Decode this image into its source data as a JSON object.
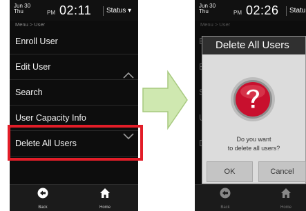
{
  "left_screen": {
    "date_line1": "Jun  30",
    "date_line2": "Thu",
    "ampm": "PM",
    "time": "02:11",
    "status_label": "Status ▾",
    "breadcrumb": "Menu > User",
    "menu_items": [
      "Enroll User",
      "Edit User",
      "Search",
      "User Capacity Info",
      "Delete All Users"
    ],
    "nav": {
      "back": "Back",
      "home": "Home"
    }
  },
  "right_screen": {
    "date_line1": "Jun  30",
    "date_line2": "Thu",
    "ampm": "PM",
    "time": "02:26",
    "status_label": "Statu",
    "breadcrumb": "Menu > User",
    "dimmed_items": [
      "E",
      "E",
      "S",
      "U",
      "D"
    ],
    "dialog": {
      "title": "Delete All Users",
      "message_line1": "Do you want",
      "message_line2": "to delete all users?",
      "ok_label": "OK",
      "cancel_label": "Cancel"
    },
    "nav": {
      "back": "Back",
      "home": "Home"
    }
  },
  "icons": {
    "scroll_up": "chevron-up-icon",
    "scroll_down": "chevron-down-icon",
    "back": "back-arrow-icon",
    "home": "home-icon",
    "question": "question-mark-icon",
    "transition": "right-arrow-icon"
  },
  "colors": {
    "highlight": "#e21d28",
    "question_red": "#c8102e",
    "arrow_green": "#cfe8b0"
  }
}
